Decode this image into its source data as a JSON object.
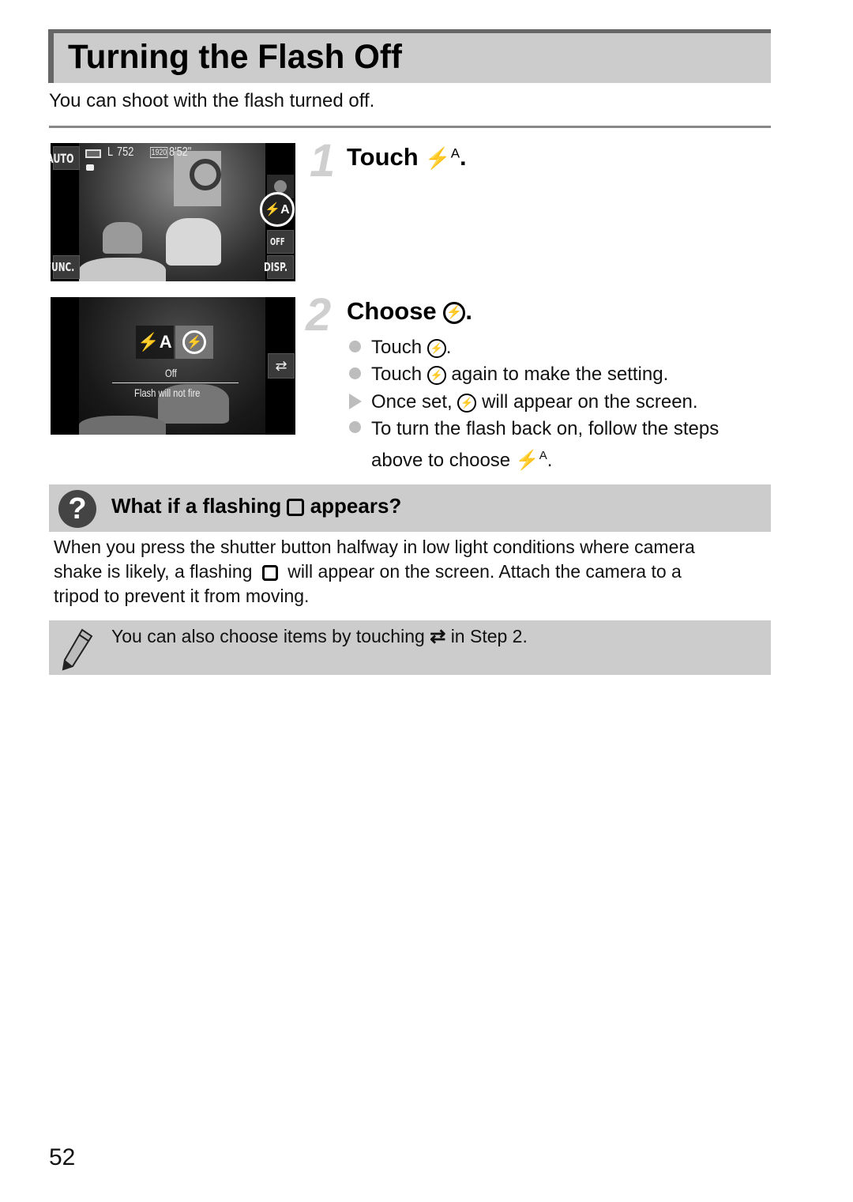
{
  "header": {
    "title": "Turning the Flash Off",
    "intro": "You can shoot with the flash turned off."
  },
  "screen1": {
    "mode_label": "AUTO",
    "shots_remaining": "752",
    "image_size": "L",
    "video_quality": "1920",
    "record_time": "8'52\"",
    "func_label": "FUNC.",
    "disp_label": "DISP.",
    "flash_button": "⚡A",
    "off_label": "OFF"
  },
  "screen2": {
    "option_auto": "⚡A",
    "option_off": "⚡",
    "selected_name": "Off",
    "selected_description": "Flash will not fire"
  },
  "steps": [
    {
      "number": "1",
      "title_prefix": "Touch",
      "title_icon": "flash-auto-icon",
      "title_suffix": "."
    },
    {
      "number": "2",
      "title_prefix": "Choose",
      "title_icon": "flash-off-icon",
      "title_suffix": ".",
      "bullets": [
        {
          "type": "dot",
          "prefix": "Touch",
          "icon": "flash-off-icon",
          "suffix": "."
        },
        {
          "type": "dot",
          "prefix": "Touch",
          "icon": "flash-off-icon",
          "suffix": "again to make the setting."
        },
        {
          "type": "arrow",
          "prefix": "Once set,",
          "icon": "flash-off-icon",
          "suffix": "will appear on the screen."
        },
        {
          "type": "dot",
          "line1": "To turn the flash back on, follow the steps",
          "line2_prefix": "above to choose",
          "icon": "flash-auto-icon",
          "line2_suffix": "."
        }
      ]
    }
  ],
  "faq": {
    "title_prefix": "What if a flashing",
    "icon": "camera-shake-icon",
    "title_suffix": "appears?",
    "body_line1": "When you press the shutter button halfway in low light conditions where camera",
    "body_line2_prefix": "shake is likely, a flashing",
    "body_line2_suffix": "will appear on the screen. Attach the camera to a",
    "body_line3": "tripod to prevent it from moving."
  },
  "note": {
    "prefix": "You can also choose items by touching",
    "icon": "toggle-icon",
    "suffix": "in Step 2."
  },
  "page_number": "52"
}
